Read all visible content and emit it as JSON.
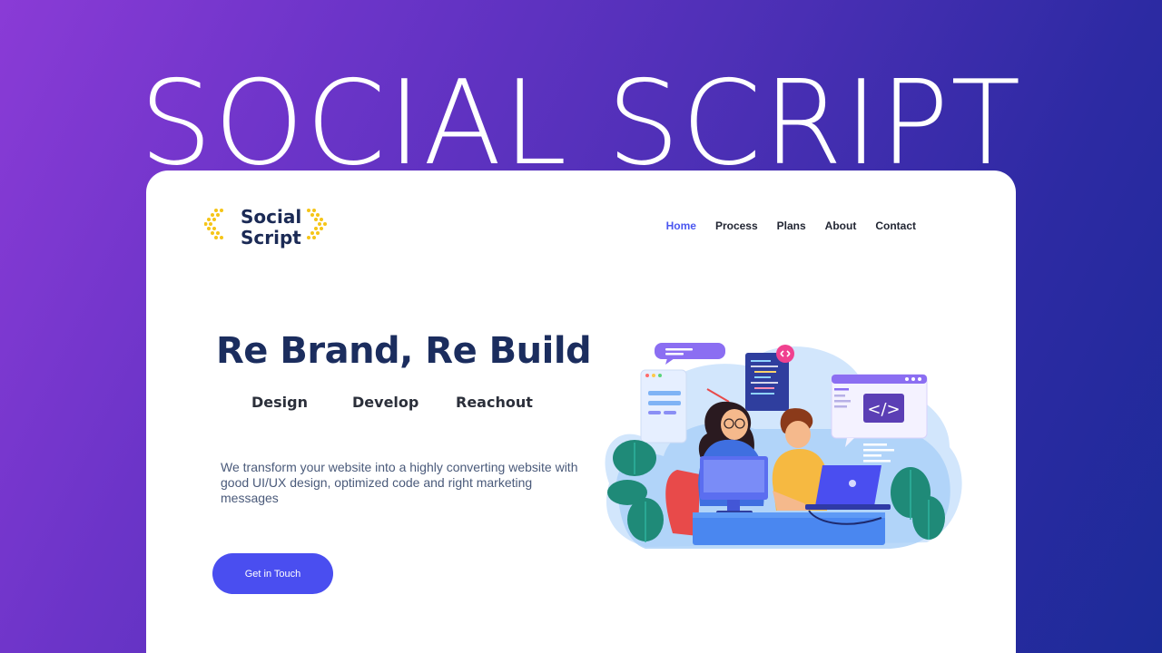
{
  "hero_title": "SOCIAL SCRIPT",
  "logo": {
    "line1": "Social",
    "line2": "Script",
    "accent": "#f5c518"
  },
  "nav": {
    "items": [
      {
        "label": "Home",
        "active": true
      },
      {
        "label": "Process"
      },
      {
        "label": "Plans"
      },
      {
        "label": "About"
      },
      {
        "label": "Contact"
      }
    ]
  },
  "headline": "Re Brand, Re Build",
  "services": [
    "Design",
    "Develop",
    "Reachout"
  ],
  "description": "We transform your website into a highly converting website with good UI/UX design, optimized code and right marketing messages",
  "cta_label": "Get in Touch",
  "illustration": {
    "code_tag": "</>"
  },
  "colors": {
    "accent": "#4a4ef0",
    "headline": "#1b2d5e",
    "gradient_start": "#8a3bd6",
    "gradient_end": "#1c2b98"
  }
}
